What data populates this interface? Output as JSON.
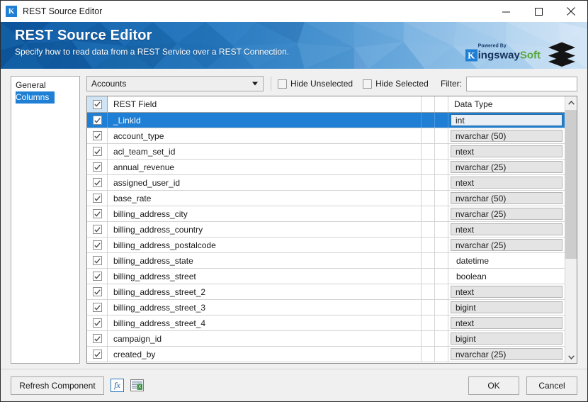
{
  "window": {
    "title": "REST Source Editor",
    "app_icon": "k-logo-icon",
    "minimize_icon": "minimize-icon",
    "maximize_icon": "maximize-icon",
    "close_icon": "close-icon"
  },
  "banner": {
    "title": "REST Source Editor",
    "subtitle": "Specify how to read data from a REST Service over a REST Connection.",
    "brand": {
      "powered_by": "Powered By",
      "name_first": "ingsway",
      "name_second": "Soft",
      "letter": "K",
      "logo_icon": "stacked-layers-icon"
    },
    "colors": {
      "gradient_start": "#0f5ca8",
      "gradient_end": "#cfe2f4",
      "brand_green": "#57a639",
      "brand_navy": "#16325c"
    }
  },
  "sidebar": {
    "items": [
      {
        "label": "General",
        "selected": false
      },
      {
        "label": "Columns",
        "selected": true
      }
    ]
  },
  "toolbar": {
    "entity_combo": {
      "value": "Accounts",
      "arrow_icon": "chevron-down-icon"
    },
    "hide_unselected": {
      "label": "Hide Unselected",
      "checked": false
    },
    "hide_selected": {
      "label": "Hide Selected",
      "checked": false
    },
    "filter": {
      "label": "Filter:",
      "value": "",
      "placeholder": ""
    }
  },
  "grid": {
    "columns": {
      "check": "",
      "field": "REST Field",
      "type": "Data Type"
    },
    "header_checked": true,
    "rows": [
      {
        "checked": true,
        "field": "_LinkId",
        "type": "int",
        "selected": true,
        "flat": false
      },
      {
        "checked": true,
        "field": "account_type",
        "type": "nvarchar (50)",
        "selected": false,
        "flat": false
      },
      {
        "checked": true,
        "field": "acl_team_set_id",
        "type": "ntext",
        "selected": false,
        "flat": false
      },
      {
        "checked": true,
        "field": "annual_revenue",
        "type": "nvarchar (25)",
        "selected": false,
        "flat": false
      },
      {
        "checked": true,
        "field": "assigned_user_id",
        "type": "ntext",
        "selected": false,
        "flat": false
      },
      {
        "checked": true,
        "field": "base_rate",
        "type": "nvarchar (50)",
        "selected": false,
        "flat": false
      },
      {
        "checked": true,
        "field": "billing_address_city",
        "type": "nvarchar (25)",
        "selected": false,
        "flat": false
      },
      {
        "checked": true,
        "field": "billing_address_country",
        "type": "ntext",
        "selected": false,
        "flat": false
      },
      {
        "checked": true,
        "field": "billing_address_postalcode",
        "type": "nvarchar (25)",
        "selected": false,
        "flat": false
      },
      {
        "checked": true,
        "field": "billing_address_state",
        "type": "datetime",
        "selected": false,
        "flat": true
      },
      {
        "checked": true,
        "field": "billing_address_street",
        "type": "boolean",
        "selected": false,
        "flat": true
      },
      {
        "checked": true,
        "field": "billing_address_street_2",
        "type": "ntext",
        "selected": false,
        "flat": false
      },
      {
        "checked": true,
        "field": "billing_address_street_3",
        "type": "bigint",
        "selected": false,
        "flat": false
      },
      {
        "checked": true,
        "field": "billing_address_street_4",
        "type": "ntext",
        "selected": false,
        "flat": false
      },
      {
        "checked": true,
        "field": "campaign_id",
        "type": "bigint",
        "selected": false,
        "flat": false
      },
      {
        "checked": true,
        "field": "created_by",
        "type": "nvarchar (25)",
        "selected": false,
        "flat": false
      }
    ],
    "scrollbar": {
      "up_icon": "chevron-up-icon",
      "down_icon": "chevron-down-icon"
    }
  },
  "footer": {
    "refresh_label": "Refresh Component",
    "fx_icon": "fx-expression-icon",
    "export_icon": "excel-export-icon",
    "ok_label": "OK",
    "cancel_label": "Cancel"
  }
}
